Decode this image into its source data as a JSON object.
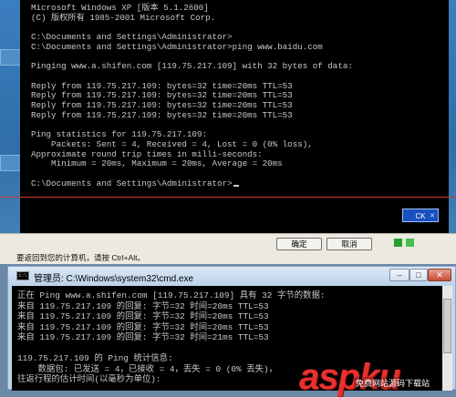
{
  "top_console": {
    "lines": [
      "Microsoft Windows XP [版本 5.1.2600]",
      "(C) 版权所有 1985-2001 Microsoft Corp.",
      "",
      "C:\\Documents and Settings\\Administrator>",
      "C:\\Documents and Settings\\Administrator>ping www.baidu.com",
      "",
      "Pinging www.a.shifen.com [119.75.217.109] with 32 bytes of data:",
      "",
      "Reply from 119.75.217.109: bytes=32 time=20ms TTL=53",
      "Reply from 119.75.217.109: bytes=32 time=20ms TTL=53",
      "Reply from 119.75.217.109: bytes=32 time=20ms TTL=53",
      "Reply from 119.75.217.109: bytes=32 time=20ms TTL=53",
      "",
      "Ping statistics for 119.75.217.109:",
      "    Packets: Sent = 4, Received = 4, Lost = 0 (0% loss),",
      "Approximate round trip times in milli-seconds:",
      "    Minimum = 20ms, Maximum = 20ms, Average = 20ms",
      "",
      "C:\\Documents and Settings\\Administrator>"
    ],
    "ok_badge": "CK"
  },
  "hint_bar": {
    "text": "要返回到您的计算机，请按 Ctrl+Alt。",
    "ok_label": "确定",
    "cancel_label": "取消"
  },
  "cmd_window": {
    "title": "管理员: C:\\Windows\\system32\\cmd.exe",
    "icon_text": "C:\\",
    "lines": [
      "正在 Ping www.a.shifen.com [119.75.217.109] 具有 32 字节的数据:",
      "来自 119.75.217.109 的回复: 字节=32 时间=20ms TTL=53",
      "来自 119.75.217.109 的回复: 字节=32 时间=20ms TTL=53",
      "来自 119.75.217.109 的回复: 字节=32 时间=20ms TTL=53",
      "来自 119.75.217.109 的回复: 字节=32 时间=21ms TTL=53",
      "",
      "119.75.217.109 的 Ping 统计信息:",
      "    数据包: 已发送 = 4，已接收 = 4，丢失 = 0 (0% 丢失)，",
      "往返行程的估计时间(以毫秒为单位):"
    ]
  },
  "watermark": {
    "logo": "aspku",
    "sub": "免费网站源码下载站"
  }
}
